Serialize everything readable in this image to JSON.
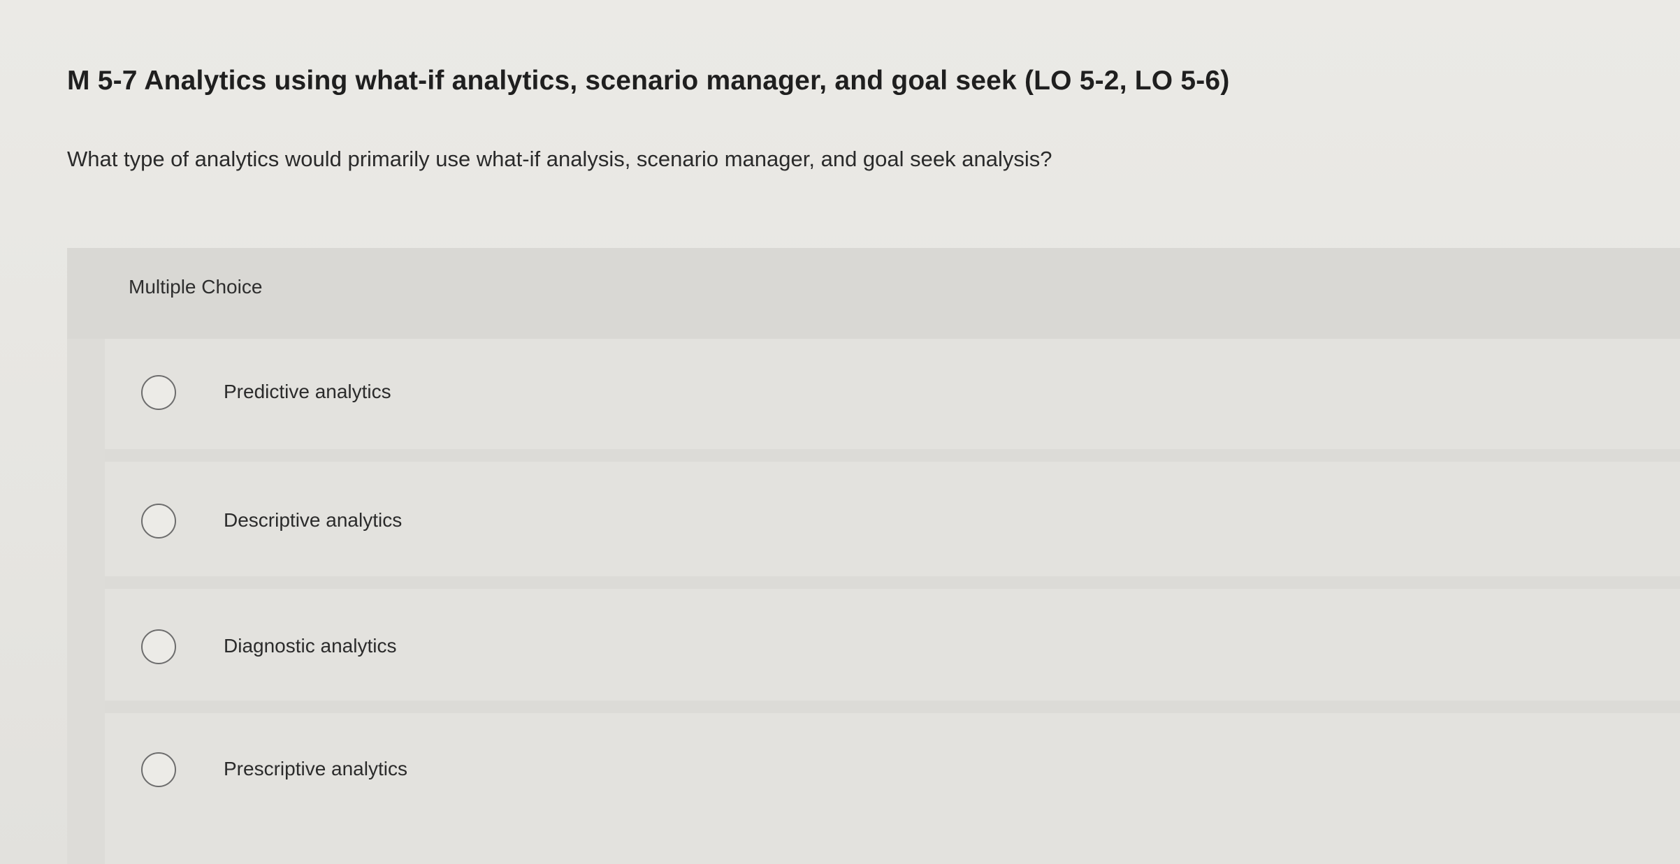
{
  "question": {
    "title": "M 5-7 Analytics using what-if analytics, scenario manager, and goal seek (LO 5-2, LO 5-6)",
    "prompt": "What type of analytics would primarily use what-if analysis, scenario manager, and goal seek analysis?"
  },
  "choices": {
    "label": "Multiple Choice",
    "options": [
      {
        "label": "Predictive analytics",
        "selected": false
      },
      {
        "label": "Descriptive analytics",
        "selected": false
      },
      {
        "label": "Diagnostic analytics",
        "selected": false
      },
      {
        "label": "Prescriptive analytics",
        "selected": false
      }
    ]
  }
}
